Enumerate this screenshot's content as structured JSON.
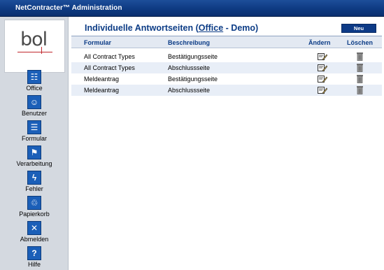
{
  "window": {
    "title": "NetContracter™ Administration"
  },
  "logo": {
    "text": "bol"
  },
  "nav": [
    {
      "label": "Office",
      "icon": "office-icon",
      "glyph": "☷"
    },
    {
      "label": "Benutzer",
      "icon": "users-icon",
      "glyph": "☺"
    },
    {
      "label": "Formular",
      "icon": "form-icon",
      "glyph": "☰"
    },
    {
      "label": "Verarbeitung",
      "icon": "processing-icon",
      "glyph": "⚑"
    },
    {
      "label": "Fehler",
      "icon": "error-bolt-icon",
      "glyph": "ϟ"
    },
    {
      "label": "Papierkorb",
      "icon": "trash-icon",
      "glyph": "♲"
    },
    {
      "label": "Abmelden",
      "icon": "logout-icon",
      "glyph": "✕"
    },
    {
      "label": "Hilfe",
      "icon": "help-icon",
      "glyph": "?"
    }
  ],
  "page": {
    "title_prefix": "Individuelle Antwortseiten (",
    "title_link": "Office",
    "title_suffix": " - Demo)",
    "new_button": "Neu"
  },
  "table": {
    "columns": [
      "Formular",
      "Beschreibung",
      "Ändern",
      "Löschen"
    ],
    "rows": [
      {
        "formular": "All Contract Types",
        "beschreibung": "Bestätigungsseite"
      },
      {
        "formular": "All Contract Types",
        "beschreibung": "Abschlussseite"
      },
      {
        "formular": "Meldeantrag",
        "beschreibung": "Bestätigungsseite"
      },
      {
        "formular": "Meldeantrag",
        "beschreibung": "Abschlussseite"
      }
    ]
  },
  "colors": {
    "titlebar": "#0e3a82",
    "sidebar": "#d4d9e0",
    "accent": "#0c3c86",
    "row_alt": "#e8eef7",
    "icon_blue": "#1b5fb8"
  }
}
